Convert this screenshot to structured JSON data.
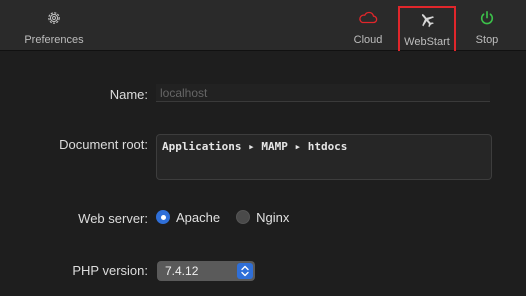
{
  "toolbar": {
    "preferences_label": "Preferences",
    "cloud_label": "Cloud",
    "webstart_label": "WebStart",
    "stop_label": "Stop",
    "colors": {
      "cloud": "#e0262b",
      "stop": "#3cc24a",
      "highlight": "#e0262b"
    }
  },
  "form": {
    "name_label": "Name:",
    "name_placeholder": "localhost",
    "docroot_label": "Document root:",
    "docroot_path": "Applications ▸ MAMP ▸ htdocs",
    "webserver_label": "Web server:",
    "webserver_options": [
      "Apache",
      "Nginx"
    ],
    "webserver_selected": "Apache",
    "php_label": "PHP version:",
    "php_value": "7.4.12"
  }
}
